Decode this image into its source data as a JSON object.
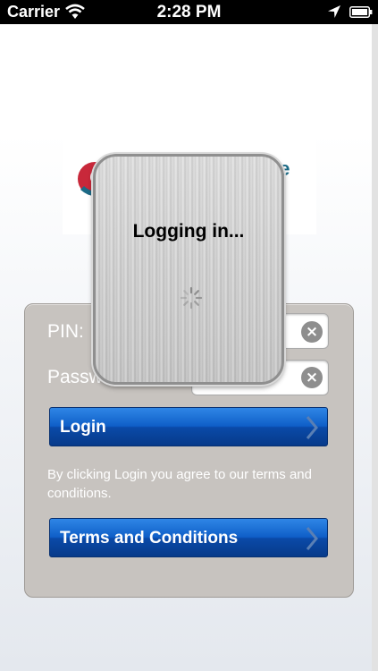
{
  "status_bar": {
    "carrier": "Carrier",
    "time": "2:28 PM",
    "icons": [
      "wifi-icon",
      "location-arrow-icon",
      "battery-icon"
    ]
  },
  "logo": {
    "visible_text": "ile"
  },
  "form": {
    "pin_label": "PIN:",
    "password_label": "Passw",
    "password_value_visible": "••",
    "login_button": "Login",
    "terms_notice": "By clicking Login you agree to our terms and conditions.",
    "terms_button": "Terms and Conditions"
  },
  "loading_hud": {
    "message": "Logging in..."
  },
  "colors": {
    "button_blue": "#0f5fc8",
    "panel_gray": "#c7c3bf",
    "logo_teal": "#1b6a86",
    "logo_red": "#c8283a"
  }
}
